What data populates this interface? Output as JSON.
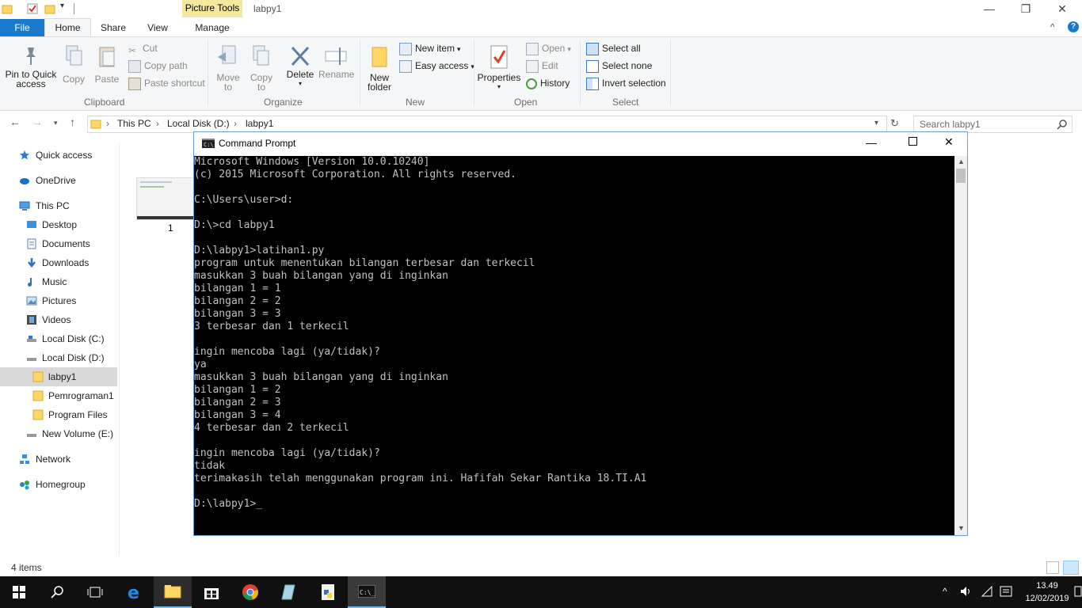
{
  "window": {
    "title": "labpy1",
    "context_tab": "Picture Tools",
    "minimize_glyph": "—",
    "restore_glyph": "❐",
    "close_glyph": "✕",
    "collapse_glyph": "^",
    "help_glyph": "?"
  },
  "tabs": [
    "File",
    "Home",
    "Share",
    "View",
    "Manage"
  ],
  "ribbon": {
    "clipboard": {
      "label": "Clipboard",
      "pin": "Pin to Quick access",
      "copy": "Copy",
      "paste": "Paste",
      "cut": "Cut",
      "copy_path": "Copy path",
      "paste_shortcut": "Paste shortcut"
    },
    "organize": {
      "label": "Organize",
      "move_to": "Move to",
      "copy_to": "Copy to",
      "delete": "Delete",
      "rename": "Rename"
    },
    "new": {
      "label": "New",
      "new_folder": "New folder",
      "new_item": "New item",
      "easy_access": "Easy access"
    },
    "open": {
      "label": "Open",
      "properties": "Properties",
      "open": "Open",
      "edit": "Edit",
      "history": "History"
    },
    "select": {
      "label": "Select",
      "select_all": "Select all",
      "select_none": "Select none",
      "invert": "Invert selection"
    }
  },
  "address": {
    "crumbs": [
      "This PC",
      "Local Disk (D:)",
      "labpy1"
    ],
    "separator": "›",
    "search_placeholder": "Search labpy1"
  },
  "nav": [
    {
      "label": "Quick access",
      "icon": "star-icon"
    },
    {
      "label": "OneDrive",
      "icon": "cloud-icon"
    },
    {
      "label": "This PC",
      "icon": "computer-icon"
    },
    {
      "label": "Desktop",
      "icon": "desktop-icon"
    },
    {
      "label": "Documents",
      "icon": "documents-icon"
    },
    {
      "label": "Downloads",
      "icon": "download-icon"
    },
    {
      "label": "Music",
      "icon": "music-icon"
    },
    {
      "label": "Pictures",
      "icon": "pictures-icon"
    },
    {
      "label": "Videos",
      "icon": "videos-icon"
    },
    {
      "label": "Local Disk (C:)",
      "icon": "drive-icon"
    },
    {
      "label": "Local Disk (D:)",
      "icon": "drive-icon"
    },
    {
      "label": "labpy1",
      "icon": "folder-icon"
    },
    {
      "label": "Pemrograman1",
      "icon": "folder-icon"
    },
    {
      "label": "Program Files",
      "icon": "folder-icon"
    },
    {
      "label": "New Volume (E:)",
      "icon": "drive-icon"
    },
    {
      "label": "Network",
      "icon": "network-icon"
    },
    {
      "label": "Homegroup",
      "icon": "homegroup-icon"
    }
  ],
  "file_item": {
    "name": "1"
  },
  "status": {
    "items": "4 items"
  },
  "cmd": {
    "title": "Command Prompt",
    "lines": [
      "Microsoft Windows [Version 10.0.10240]",
      "(c) 2015 Microsoft Corporation. All rights reserved.",
      "",
      "C:\\Users\\user>d:",
      "",
      "D:\\>cd labpy1",
      "",
      "D:\\labpy1>latihan1.py",
      "program untuk menentukan bilangan terbesar dan terkecil",
      "masukkan 3 buah bilangan yang di inginkan",
      "bilangan 1 = 1",
      "bilangan 2 = 2",
      "bilangan 3 = 3",
      "3 terbesar dan 1 terkecil",
      "",
      "ingin mencoba lagi (ya/tidak)?",
      "ya",
      "masukkan 3 buah bilangan yang di inginkan",
      "bilangan 1 = 2",
      "bilangan 2 = 3",
      "bilangan 3 = 4",
      "4 terbesar dan 2 terkecil",
      "",
      "ingin mencoba lagi (ya/tidak)?",
      "tidak",
      "terimakasih telah menggunakan program ini. Hafifah Sekar Rantika 18.TI.A1",
      "",
      "D:\\labpy1>"
    ],
    "cursor": "_"
  },
  "taskbar": {
    "time": "13.49",
    "date": "12/02/2019"
  },
  "colors": {
    "accent": "#1979ca",
    "taskbar": "#101010",
    "console_bg": "#000000",
    "console_fg": "#c0c0c0",
    "folder": "#ffd766"
  }
}
